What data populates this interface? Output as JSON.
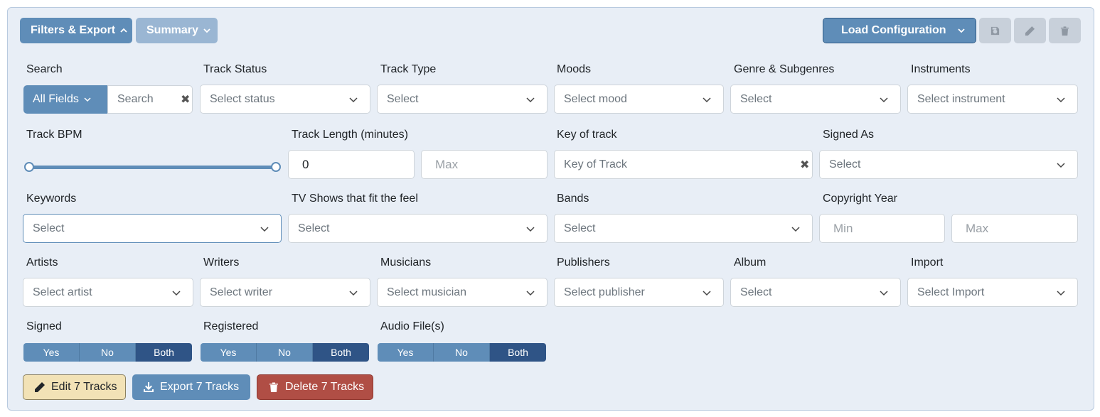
{
  "header": {
    "filters_label": "Filters & Export",
    "summary_label": "Summary",
    "load_config_label": "Load Configuration"
  },
  "fields": {
    "search": {
      "label": "Search",
      "scope": "All Fields",
      "placeholder": "Search"
    },
    "track_status": {
      "label": "Track Status",
      "placeholder": "Select status"
    },
    "track_type": {
      "label": "Track Type",
      "placeholder": "Select"
    },
    "moods": {
      "label": "Moods",
      "placeholder": "Select mood"
    },
    "genre": {
      "label": "Genre & Subgenres",
      "placeholder": "Select"
    },
    "instruments": {
      "label": "Instruments",
      "placeholder": "Select instrument"
    },
    "bpm": {
      "label": "Track BPM",
      "range_fraction": [
        0,
        1
      ]
    },
    "track_length": {
      "label": "Track Length (minutes)",
      "min_value": "0",
      "max_placeholder": "Max"
    },
    "key": {
      "label": "Key of track",
      "placeholder": "Key of Track"
    },
    "signed_as": {
      "label": "Signed As",
      "placeholder": "Select"
    },
    "keywords": {
      "label": "Keywords",
      "placeholder": "Select"
    },
    "tv_shows": {
      "label": "TV Shows that fit the feel",
      "placeholder": "Select"
    },
    "bands": {
      "label": "Bands",
      "placeholder": "Select"
    },
    "copyright": {
      "label": "Copyright Year",
      "min_placeholder": "Min",
      "max_placeholder": "Max"
    },
    "artists": {
      "label": "Artists",
      "placeholder": "Select artist"
    },
    "writers": {
      "label": "Writers",
      "placeholder": "Select writer"
    },
    "musicians": {
      "label": "Musicians",
      "placeholder": "Select musician"
    },
    "publishers": {
      "label": "Publishers",
      "placeholder": "Select publisher"
    },
    "album": {
      "label": "Album",
      "placeholder": "Select"
    },
    "import": {
      "label": "Import",
      "placeholder": "Select Import"
    }
  },
  "toggles": {
    "signed": {
      "label": "Signed",
      "options": [
        "Yes",
        "No",
        "Both"
      ],
      "selected": "Both"
    },
    "registered": {
      "label": "Registered",
      "options": [
        "Yes",
        "No",
        "Both"
      ],
      "selected": "Both"
    },
    "audio_files": {
      "label": "Audio File(s)",
      "options": [
        "Yes",
        "No",
        "Both"
      ],
      "selected": "Both"
    }
  },
  "actions": {
    "edit_label": "Edit 7 Tracks",
    "export_label": "Export 7 Tracks",
    "delete_label": "Delete 7 Tracks"
  },
  "icons": {
    "save": "save-icon",
    "edit": "pencil-icon",
    "delete": "trash-icon",
    "clear": "close-icon"
  },
  "colors": {
    "primary": "#5f8db8",
    "primary_dark": "#2f5486",
    "danger": "#b04e45",
    "warning_light": "#f2e2b6",
    "panel_bg": "#e8eef6"
  }
}
